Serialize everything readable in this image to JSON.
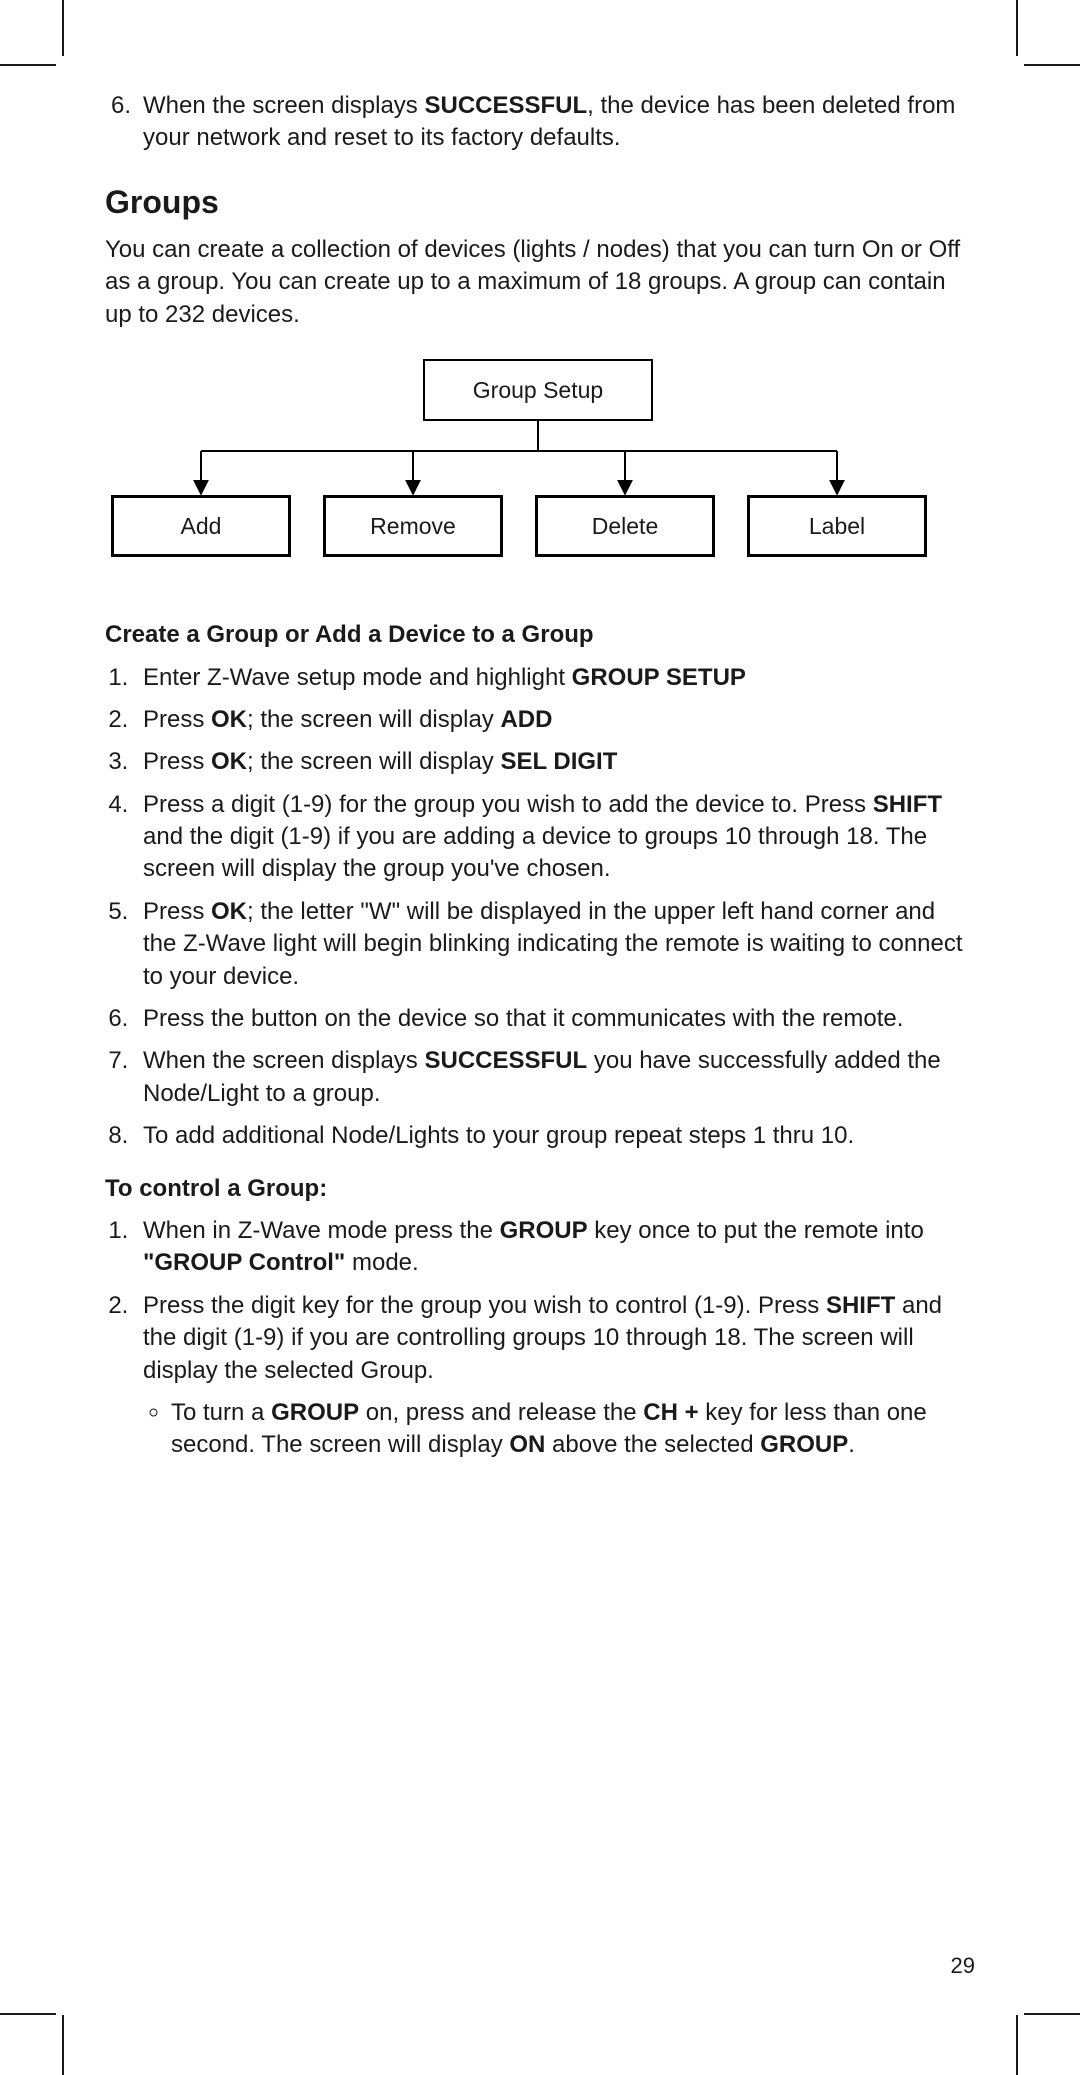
{
  "lead_step": {
    "num": "6.",
    "pre": "When the screen displays ",
    "bold": "SUCCESSFUL",
    "post": ", the device has been deleted from your network and reset to its factory defaults."
  },
  "section_title": "Groups",
  "intro": "You can create a collection of devices (lights / nodes) that you can turn On or Off as a group. You can create up to a maximum of 18 groups. A group can contain up to 232 devices.",
  "diagram": {
    "parent": "Group Setup",
    "children": [
      "Add",
      "Remove",
      "Delete",
      "Label"
    ]
  },
  "create_heading": "Create a Group or Add a Device to a Group",
  "create_steps": {
    "s1": {
      "pre": "Enter Z-Wave setup mode and highlight ",
      "b1": "GROUP SETUP",
      "post": ""
    },
    "s2": {
      "pre": "Press ",
      "b1": "OK",
      "mid": "; the screen will display ",
      "b2": "ADD",
      "post": ""
    },
    "s3": {
      "pre": "Press ",
      "b1": "OK",
      "mid": "; the screen will display ",
      "b2": "SEL DIGIT",
      "post": ""
    },
    "s4": {
      "pre": "Press a digit (1-9) for the group you wish to add the device to. Press ",
      "b1": "SHIFT",
      "post": " and the digit (1-9) if you are adding a device to groups 10 through 18. The screen will display the group you've chosen."
    },
    "s5": {
      "pre": "Press ",
      "b1": "OK",
      "post": "; the letter \"W\" will be displayed in the upper left hand corner and the Z-Wave light will begin blinking indicating the remote is waiting to connect to your device."
    },
    "s6": {
      "text": "Press the button on the device so that it communicates with the remote."
    },
    "s7": {
      "pre": "When the screen displays ",
      "b1": "SUCCESSFUL",
      "post": " you have successfully added the Node/Light to a group."
    },
    "s8": {
      "text": "To add additional Node/Lights to your group repeat steps 1 thru 10."
    }
  },
  "control_heading": "To control a Group:",
  "control_steps": {
    "s1": {
      "pre": "When in Z-Wave mode press the ",
      "b1": "GROUP",
      "mid": " key once to put the remote into ",
      "b2": "\"GROUP Control\"",
      "post": " mode."
    },
    "s2": {
      "pre": "Press the digit key for the group you wish to control (1-9). Press ",
      "b1": "SHIFT",
      "post": " and the digit (1-9) if you are controlling groups 10 through 18. The screen will display the selected Group."
    }
  },
  "control_bullet": {
    "p1": "To turn a ",
    "b1": "GROUP",
    "p2": " on, press and release the ",
    "b2": "CH +",
    "p3": " key for less than one second. The screen will display ",
    "b3": "ON",
    "p4": " above the selected ",
    "b4": "GROUP",
    "p5": "."
  },
  "page_number": "29"
}
